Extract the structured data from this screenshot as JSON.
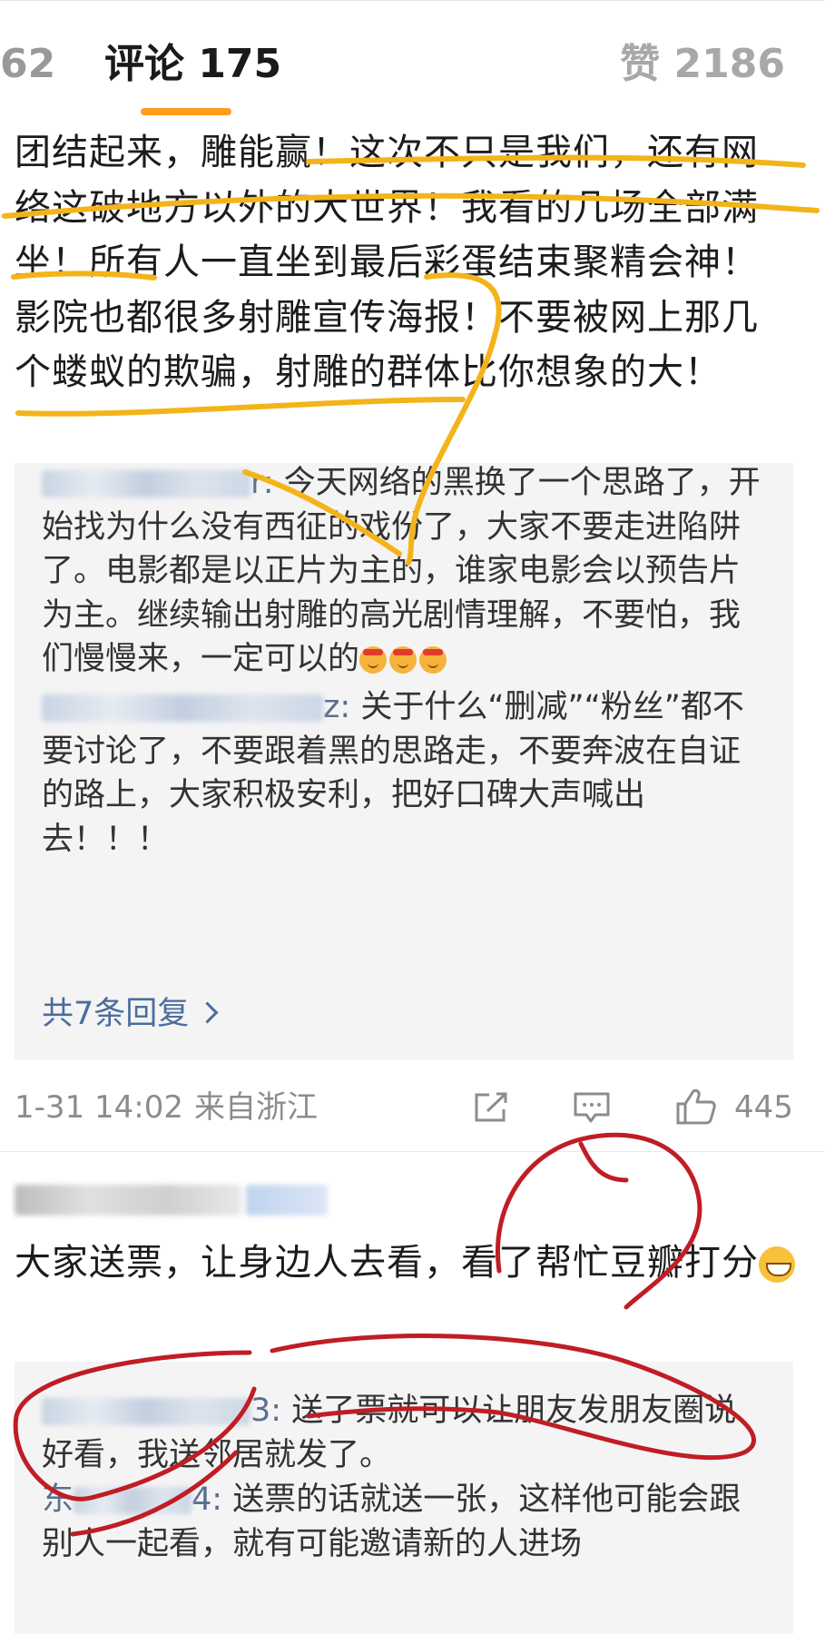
{
  "tabs": {
    "left_partial": "62",
    "comments": "评论 175",
    "likes": "赞 2186"
  },
  "comment1": {
    "text": "团结起来，雕能赢！这次不只是我们，还有网络这破地方以外的大世界！我看的几场全部满坐！所有人一直坐到最后彩蛋结束聚精会神！影院也都很多射雕宣传海报！不要被网上那几个蝼蚁的欺骗，射雕的群体比你想象的大！",
    "replies": [
      {
        "user_suffix": "r",
        "text": "今天网络的黑换了一个思路了，开始找为什么没有西征的戏份了，大家不要走进陷阱了。电影都是以正片为主的，谁家电影会以预告片为主。继续输出射雕的高光剧情理解，不要怕，我们慢慢来，一定可以的"
      },
      {
        "user_suffix": "z",
        "text": "关于什么“删减”“粉丝”都不要讨论了，不要跟着黑的思路走，不要奔波在自证的路上，大家积极安利，把好口碑大声喊出去！！！"
      }
    ],
    "more_replies": "共7条回复",
    "time": "1-31 14:02",
    "location": "来自浙江",
    "like_count": "445"
  },
  "comment2": {
    "text": "大家送票，让身边人去看，看了帮忙豆瓣打分",
    "replies": [
      {
        "user_suffix": "3",
        "text": "送了票就可以让朋友发朋友圈说好看，我送邻居就发了。"
      },
      {
        "user_prefix": "东",
        "user_suffix": "4",
        "text": "送票的话就送一张，这样他可能会跟别人一起看，就有可能邀请新的人进场"
      }
    ]
  },
  "colors": {
    "tab_underline": "#ff9b1f",
    "link": "#4a6d9e",
    "annotation_yellow": "#f3b41a",
    "annotation_red": "#c01d24"
  }
}
